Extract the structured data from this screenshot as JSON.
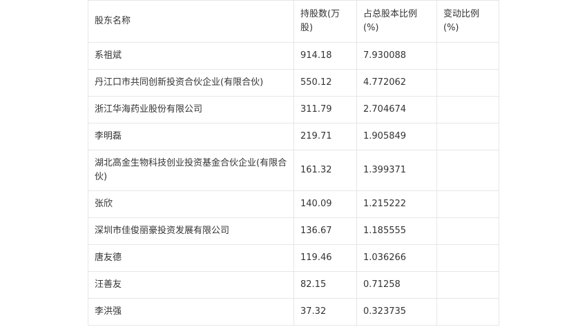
{
  "table": {
    "headers": [
      "股东名称",
      "持股数(万股)",
      "占总股本比例(%)",
      "变动比例(%)"
    ],
    "rows": [
      [
        "系祖斌",
        "914.18",
        "7.930088",
        ""
      ],
      [
        "丹江口市共同创新投资合伙企业(有限合伙)",
        "550.12",
        "4.772062",
        ""
      ],
      [
        "浙江华海药业股份有限公司",
        "311.79",
        "2.704674",
        ""
      ],
      [
        "李明磊",
        "219.71",
        "1.905849",
        ""
      ],
      [
        "湖北高金生物科技创业投资基金合伙企业(有限合伙)",
        "161.32",
        "1.399371",
        ""
      ],
      [
        "张欣",
        "140.09",
        "1.215222",
        ""
      ],
      [
        "深圳市佳俊丽豪投资发展有限公司",
        "136.67",
        "1.185555",
        ""
      ],
      [
        "唐友德",
        "119.46",
        "1.036266",
        ""
      ],
      [
        "汪善友",
        "82.15",
        "0.71258",
        ""
      ],
      [
        "李洪强",
        "37.32",
        "0.323735",
        ""
      ]
    ]
  }
}
